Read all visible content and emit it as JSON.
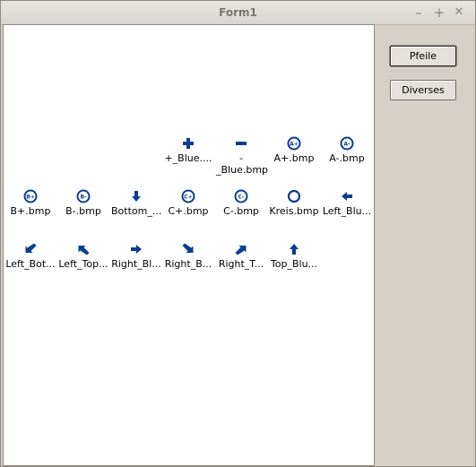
{
  "window": {
    "title": "Form1",
    "minimize": "–",
    "maximize": "+",
    "close": "✕"
  },
  "buttons": {
    "pfeile": "Pfeile",
    "diverses": "Diverses"
  },
  "items": [
    {
      "label": "+_Blue....",
      "icon": "plus-icon"
    },
    {
      "label": "-\n_Blue.bmp",
      "icon": "minus-icon"
    },
    {
      "label": "A+.bmp",
      "icon": "circle-a-plus-icon",
      "text": "A+"
    },
    {
      "label": "A-.bmp",
      "icon": "circle-a-minus-icon",
      "text": "A-"
    },
    {
      "label": "B+.bmp",
      "icon": "circle-b-plus-icon",
      "text": "B+"
    },
    {
      "label": "B-.bmp",
      "icon": "circle-b-minus-icon",
      "text": "B-"
    },
    {
      "label": "Bottom_...",
      "icon": "arrow-down-icon"
    },
    {
      "label": "C+.bmp",
      "icon": "circle-c-plus-icon",
      "text": "C+"
    },
    {
      "label": "C-.bmp",
      "icon": "circle-c-minus-icon",
      "text": "C-"
    },
    {
      "label": "Kreis.bmp",
      "icon": "circle-icon"
    },
    {
      "label": "Left_Blu...",
      "icon": "arrow-left-icon"
    },
    {
      "label": "Left_Bot...",
      "icon": "arrow-down-left-icon"
    },
    {
      "label": "Left_Top...",
      "icon": "arrow-up-left-icon"
    },
    {
      "label": "Right_Bl...",
      "icon": "arrow-right-icon"
    },
    {
      "label": "Right_B...",
      "icon": "arrow-down-right-icon"
    },
    {
      "label": "Right_T...",
      "icon": "arrow-up-right-icon"
    },
    {
      "label": "Top_Blu...",
      "icon": "arrow-up-icon"
    }
  ],
  "colors": {
    "icon": "#0a3d91",
    "icon_fill": "#1f63c9"
  }
}
